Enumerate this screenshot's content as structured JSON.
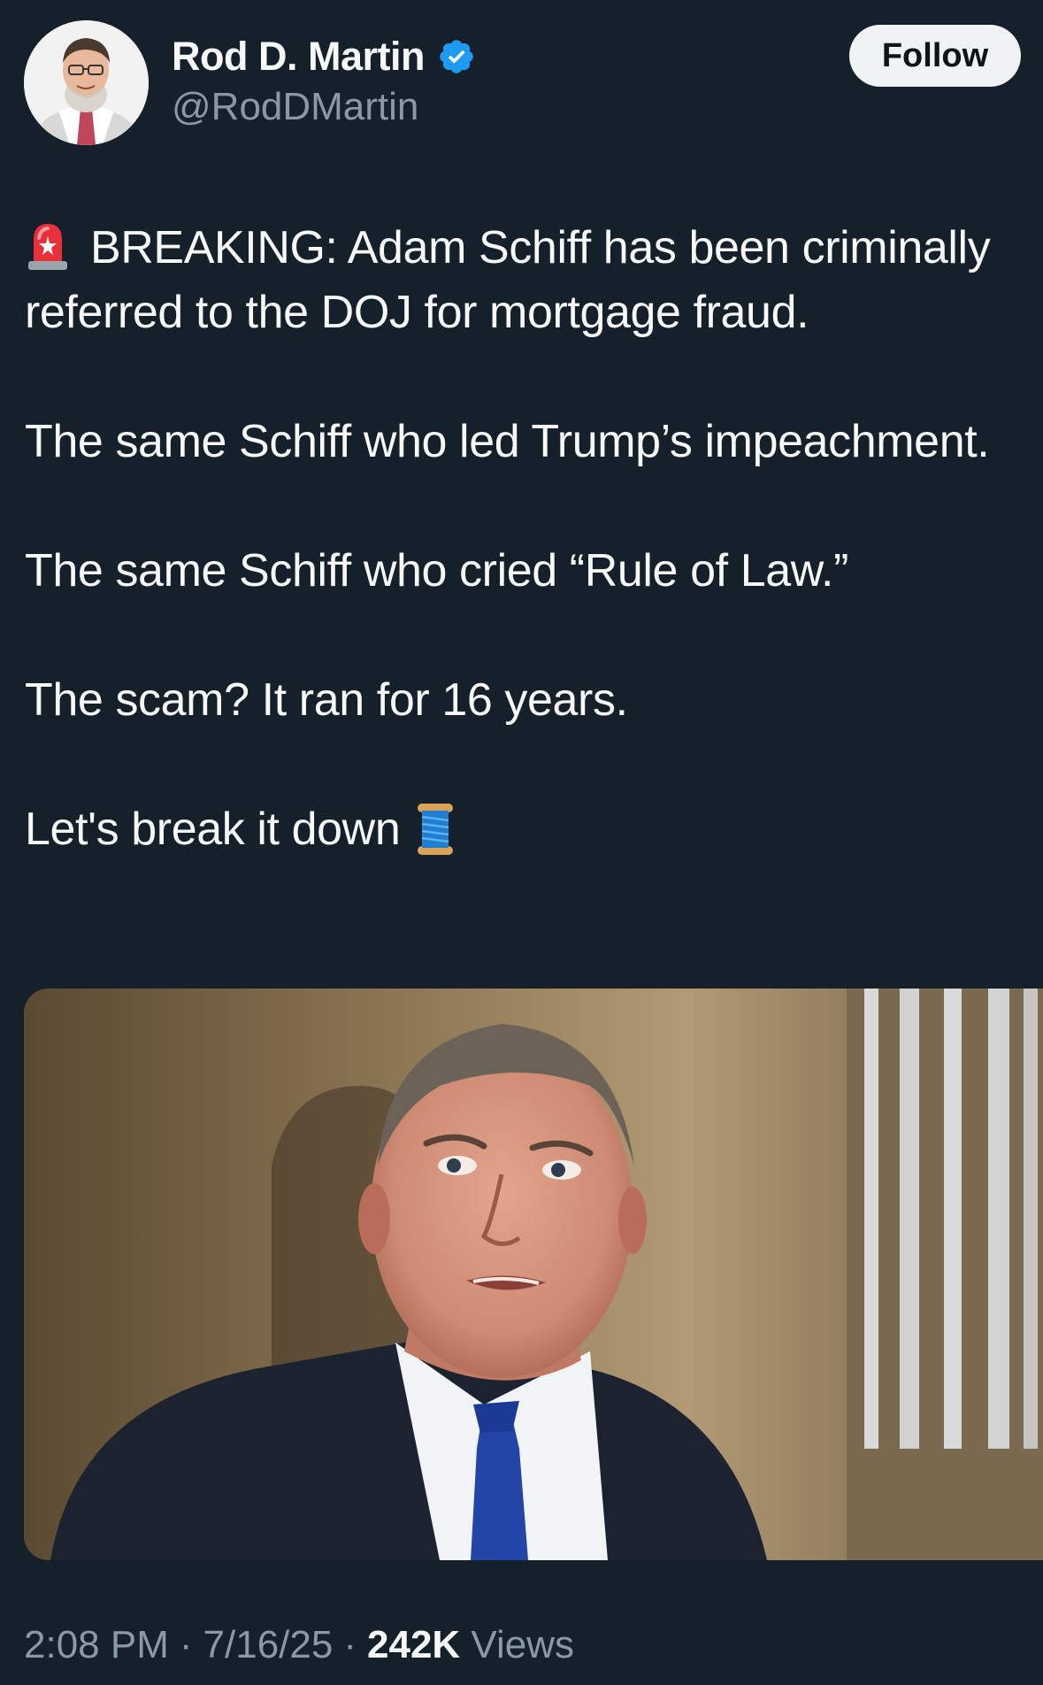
{
  "author": {
    "name": "Rod D. Martin",
    "handle": "@RodDMartin",
    "verified": true,
    "verified_color": "#1d9bf0"
  },
  "follow_button": {
    "label": "Follow"
  },
  "tweet": {
    "paragraphs": [
      "BREAKING: Adam Schiff has been criminally referred to the DOJ for mortgage fraud.",
      "The same Schiff who led Trump’s impeachment.",
      "The same Schiff who cried “Rule of Law.”",
      "The scam? It ran for 16 years.",
      "Let's break it down"
    ],
    "leading_emoji": "siren-emoji",
    "trailing_emoji": "thread-spool-emoji"
  },
  "meta": {
    "time": "2:08 PM",
    "date": "7/16/25",
    "views_count": "242K",
    "views_label": "Views",
    "separator": "·"
  },
  "colors": {
    "background": "#15202b",
    "text": "#f7f9f9",
    "secondary_text": "#8b98a5",
    "follow_bg": "#eff3f4"
  }
}
